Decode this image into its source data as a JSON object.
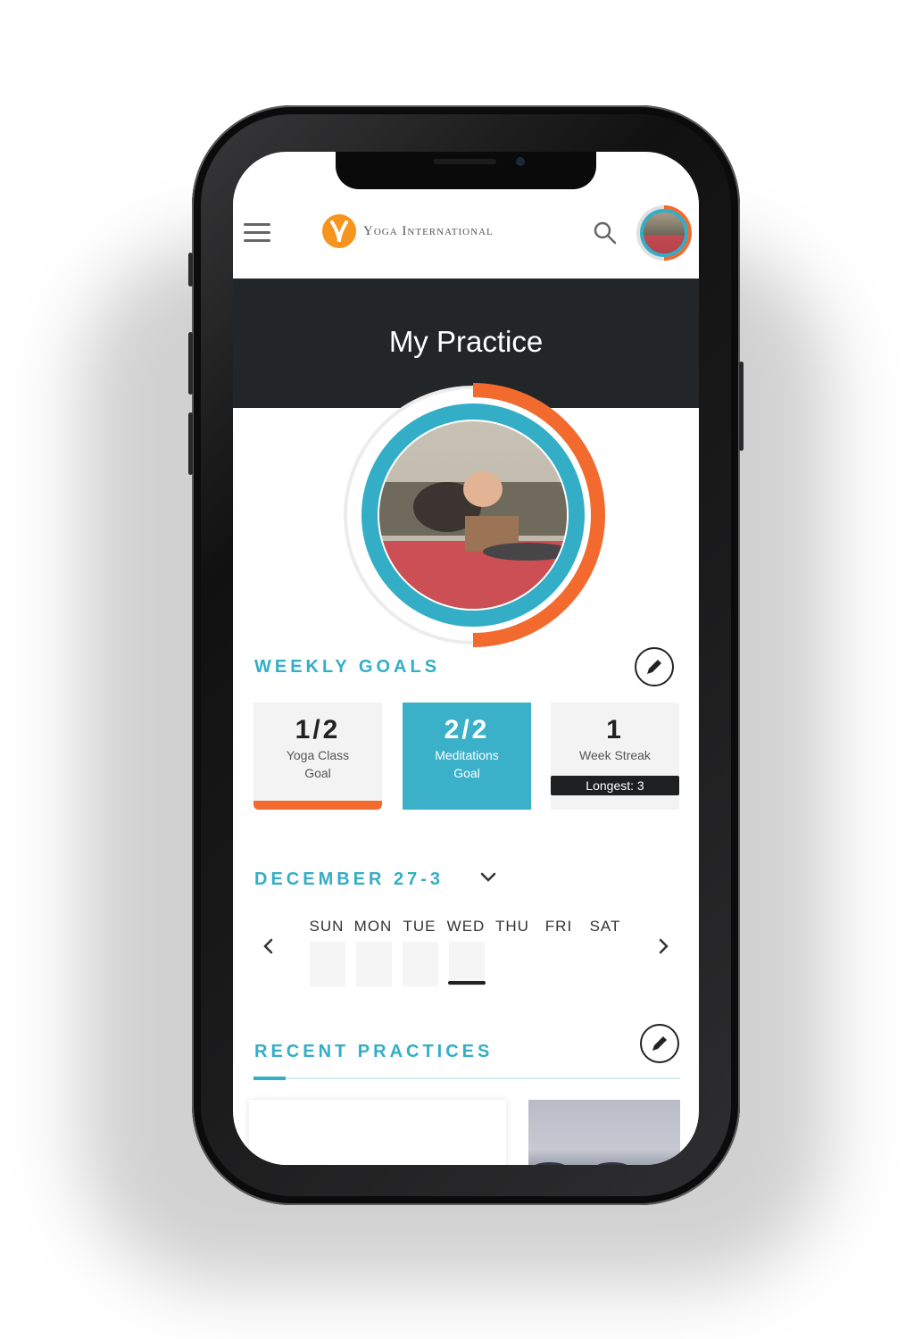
{
  "app": {
    "brand_name": "Yoga International",
    "page_title": "My Practice"
  },
  "colors": {
    "accent_teal": "#33aec6",
    "accent_orange": "#f26a2e",
    "header_dark": "#222629",
    "brand_orange": "#f7941d"
  },
  "icons": {
    "menu": "hamburger-icon",
    "search": "search-icon",
    "edit": "pencil-icon",
    "chevron_down": "chevron-down-icon",
    "prev": "chevron-left-icon",
    "next": "chevron-right-icon"
  },
  "progress": {
    "fraction": 0.5
  },
  "weekly_goals": {
    "heading": "WEEKLY GOALS",
    "cards": [
      {
        "value": "1/2",
        "label_line1": "Yoga Class",
        "label_line2": "Goal",
        "progress": 0.5
      },
      {
        "value": "2/2",
        "label_line1": "Meditations",
        "label_line2": "Goal",
        "progress": 1.0
      },
      {
        "value": "1",
        "label_line1": "Week Streak",
        "badge": "Longest: 3"
      }
    ]
  },
  "week": {
    "range_label": "DECEMBER 27-3",
    "days": [
      "SUN",
      "MON",
      "TUE",
      "WED",
      "THU",
      "FRI",
      "SAT"
    ],
    "today_index": 3
  },
  "recent_practices": {
    "heading": "RECENT PRACTICES"
  }
}
